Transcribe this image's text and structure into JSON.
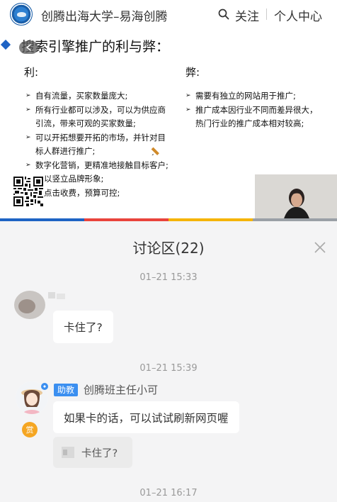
{
  "header": {
    "brand": "创腾出海大学–易海创腾",
    "follow": "关注",
    "user_center": "个人中心"
  },
  "slide": {
    "title": "搜索引擎推广的利与弊：",
    "pros_heading": "利:",
    "cons_heading": "弊:",
    "pros": [
      "自有流量，买家数量庞大;",
      "所有行业都可以涉及，可以为供应商",
      "引流，带来可观的买家数量;",
      "可以开拓想要开拓的市场，并针对目",
      "标人群进行推广;",
      "数字化营销，更精准地接触目标客户;",
      "以竖立品牌形象;",
      "点击收费，预算可控;"
    ],
    "cons": [
      "需要有独立的网站用于推广;",
      "推广成本因行业不同而差异很大，",
      "热门行业的推广成本相对较高;"
    ],
    "bar_colors": [
      "#1e63c4",
      "#e9433c",
      "#f5b400",
      "#888888"
    ]
  },
  "discussion": {
    "title": "讨论区(22)",
    "messages": [
      {
        "time": "01–21 15:33",
        "text": "卡住了?"
      },
      {
        "time": "01–21 15:39",
        "badge": "助教",
        "sender": "创腾班主任小可",
        "reward": "赏",
        "text": "如果卡的话，可以试试刷新网页喔",
        "quote": "卡住了?"
      },
      {
        "time": "01–21 16:17"
      }
    ]
  },
  "icons": [
    "logo",
    "search-icon",
    "back-icon",
    "pencil-icon",
    "qr-code",
    "close-icon"
  ],
  "colors": {
    "accent_blue": "#3b8ff0",
    "reward_orange": "#f5a623",
    "panel_bg": "#f4f4f5"
  }
}
